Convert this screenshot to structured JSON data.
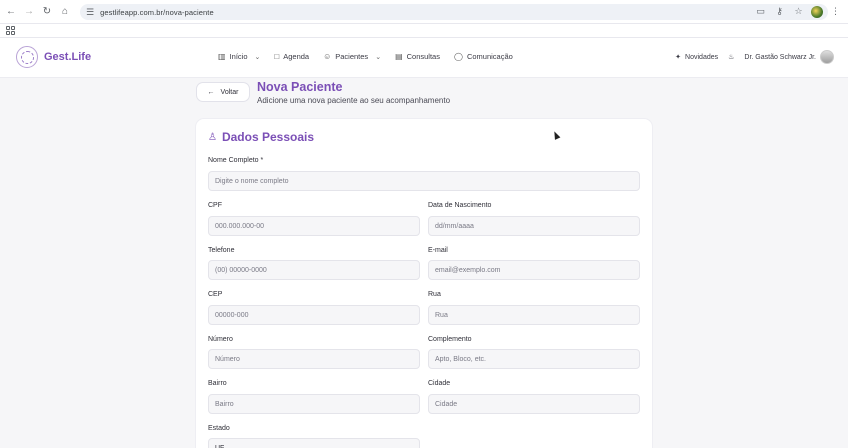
{
  "browser": {
    "url": "gestlifeapp.com.br/nova-paciente",
    "icons": [
      "back-arrow-icon",
      "forward-arrow-icon",
      "reload-icon",
      "home-icon",
      "site-info-icon",
      "install-icon",
      "key-icon",
      "star-icon",
      "profile-avatar",
      "kebab-menu-icon",
      "apps-grid-icon"
    ]
  },
  "header": {
    "logo": "Gest.Life",
    "nav": [
      {
        "label": "Início",
        "icon": "chart-icon",
        "dropdown": true
      },
      {
        "label": "Agenda",
        "icon": "calendar-icon",
        "dropdown": false
      },
      {
        "label": "Pacientes",
        "icon": "users-icon",
        "dropdown": true
      },
      {
        "label": "Consultas",
        "icon": "clipboard-icon",
        "dropdown": false
      },
      {
        "label": "Comunicação",
        "icon": "chat-icon",
        "dropdown": false
      }
    ],
    "novidades": "Novidades",
    "user_name": "Dr. Gastão Schwarz Jr."
  },
  "page": {
    "back_label": "Voltar",
    "title": "Nova Paciente",
    "subtitle": "Adicione uma nova paciente ao seu acompanhamento"
  },
  "form": {
    "section_title": "Dados Pessoais",
    "nome": {
      "label": "Nome Completo *",
      "placeholder": "Digite o nome completo"
    },
    "cpf": {
      "label": "CPF",
      "placeholder": "000.000.000-00"
    },
    "nascimento": {
      "label": "Data de Nascimento",
      "placeholder": "dd/mm/aaaa"
    },
    "telefone": {
      "label": "Telefone",
      "placeholder": "(00) 00000-0000"
    },
    "email": {
      "label": "E-mail",
      "placeholder": "email@exemplo.com"
    },
    "cep": {
      "label": "CEP",
      "placeholder": "00000-000"
    },
    "rua": {
      "label": "Rua",
      "placeholder": "Rua"
    },
    "numero": {
      "label": "Número",
      "placeholder": "Número"
    },
    "complemento": {
      "label": "Complemento",
      "placeholder": "Apto, Bloco, etc."
    },
    "bairro": {
      "label": "Bairro",
      "placeholder": "Bairro"
    },
    "cidade": {
      "label": "Cidade",
      "placeholder": "Cidade"
    },
    "estado": {
      "label": "Estado",
      "value": "UF"
    }
  },
  "colors": {
    "accent": "#7b4fb6",
    "background": "#f6f6f8"
  }
}
